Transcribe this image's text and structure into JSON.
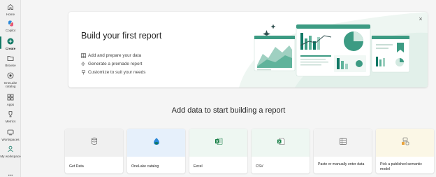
{
  "rail": {
    "items": [
      {
        "label": "Home"
      },
      {
        "label": "Copilot"
      },
      {
        "label": "Create"
      },
      {
        "label": "Browse"
      },
      {
        "label": "OneLake catalog"
      },
      {
        "label": "Apps"
      },
      {
        "label": "Metrics"
      },
      {
        "label": "Workspaces"
      },
      {
        "label": "My workspace"
      },
      {
        "label": "..."
      }
    ],
    "active_color": "#117865"
  },
  "hero": {
    "title": "Build your first report",
    "items": [
      {
        "label": "Add and prepare your data",
        "icon": "table-icon"
      },
      {
        "label": "Generate a premade report",
        "icon": "sparkle-icon"
      },
      {
        "label": "Customize to suit your needs",
        "icon": "paintbrush-icon"
      }
    ],
    "close_icon": "close-icon"
  },
  "section": {
    "title": "Add data to start building a report"
  },
  "tiles": [
    {
      "label": "Get Data",
      "icon": "database-icon",
      "bg": "#f0f0f0"
    },
    {
      "label": "OneLake catalog",
      "icon": "onelake-icon",
      "bg": "#e6f0fb"
    },
    {
      "label": "Excel",
      "icon": "excel-icon",
      "bg": "#eef7f2"
    },
    {
      "label": "CSV",
      "icon": "csv-icon",
      "bg": "#eef7f2"
    },
    {
      "label": "Paste or manually enter data",
      "icon": "table-grid-icon",
      "bg": "#f3f3f3"
    },
    {
      "label": "Pick a published semantic model",
      "icon": "semantic-model-icon",
      "bg": "#fbf7e6"
    }
  ]
}
